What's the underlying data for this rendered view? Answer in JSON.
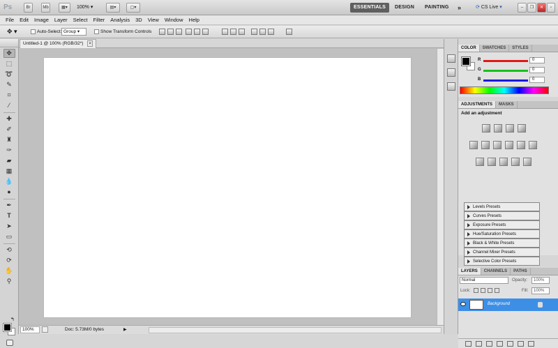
{
  "app": {
    "logo": "Ps",
    "title_buttons": [
      "Mb"
    ],
    "zoom_dropdown": "100%",
    "workspaces": [
      "ESSENTIALS",
      "DESIGN",
      "PAINTING"
    ],
    "more_workspaces": "»",
    "cs_live": "CS Live"
  },
  "menu": [
    "File",
    "Edit",
    "Image",
    "Layer",
    "Select",
    "Filter",
    "Analysis",
    "3D",
    "View",
    "Window",
    "Help"
  ],
  "options": {
    "auto_select_label": "Auto-Select:",
    "auto_select_value": "Group",
    "show_transform_label": "Show Transform Controls"
  },
  "document": {
    "tab_title": "Untitled-1 @ 100% (RGB/32*)",
    "close_glyph": "×"
  },
  "status": {
    "zoom": "100%",
    "doc_info": "Doc: 5.73M/0 bytes"
  },
  "color_panel": {
    "tabs": [
      "COLOR",
      "SWATCHES",
      "STYLES"
    ],
    "channels": [
      {
        "label": "R",
        "value": "0",
        "color": "#e01818"
      },
      {
        "label": "G",
        "value": "0",
        "color": "#18c018"
      },
      {
        "label": "B",
        "value": "0",
        "color": "#1818e0"
      }
    ]
  },
  "adjustments_panel": {
    "tabs": [
      "ADJUSTMENTS",
      "MASKS"
    ],
    "heading": "Add an adjustment",
    "presets": [
      "Levels Presets",
      "Curves Presets",
      "Exposure Presets",
      "Hue/Saturation Presets",
      "Black & White Presets",
      "Channel Mixer Presets",
      "Selective Color Presets"
    ]
  },
  "layers_panel": {
    "tabs": [
      "LAYERS",
      "CHANNELS",
      "PATHS"
    ],
    "blend_mode": "Normal",
    "opacity_label": "Opacity:",
    "opacity_value": "100%",
    "lock_label": "Lock:",
    "fill_label": "Fill:",
    "fill_value": "100%",
    "layer_name": "Background",
    "footer_icons": [
      "link-icon",
      "fx-icon",
      "mask-icon",
      "adjustment-icon",
      "folder-icon",
      "new-layer-icon",
      "trash-icon"
    ]
  },
  "colors": {
    "selected_layer": "#3d8fe6",
    "canvas": "#ffffff",
    "workspace_bg": "#c0c0c0"
  }
}
